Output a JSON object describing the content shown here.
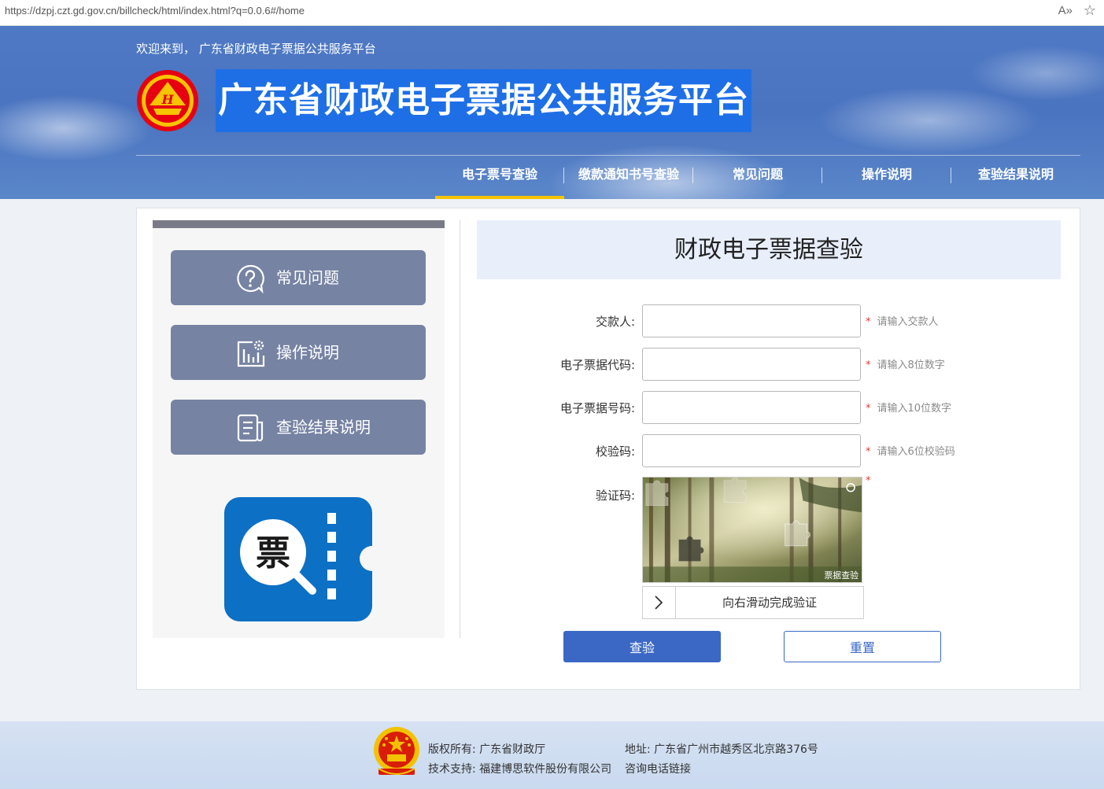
{
  "browser": {
    "url": "https://dzpj.czt.gd.gov.cn/billcheck/html/index.html?q=0.0.6#/home",
    "read_aloud": "A»",
    "favorite": "☆"
  },
  "header": {
    "welcome": "欢迎来到， 广东省财政电子票据公共服务平台",
    "title": "广东省财政电子票据公共服务平台",
    "emblem_char": "H",
    "nav": [
      "电子票号查验",
      "缴款通知书号查验",
      "常见问题",
      "操作说明",
      "查验结果说明"
    ],
    "active_nav": "电子票号查验"
  },
  "sidebar": {
    "items": [
      {
        "label": "常见问题",
        "icon": "question-icon"
      },
      {
        "label": "操作说明",
        "icon": "chart-settings-icon"
      },
      {
        "label": "查验结果说明",
        "icon": "document-icon"
      }
    ],
    "ticket_char": "票"
  },
  "form": {
    "heading": "财政电子票据查验",
    "fields": [
      {
        "label": "交款人:",
        "value": "",
        "hint": "请输入交款人"
      },
      {
        "label": "电子票据代码:",
        "value": "",
        "hint": "请输入8位数字"
      },
      {
        "label": "电子票据号码:",
        "value": "",
        "hint": "请输入10位数字"
      },
      {
        "label": "校验码:",
        "value": "",
        "hint": "请输入6位校验码"
      }
    ],
    "captcha_label": "验证码:",
    "captcha_watermark": "票据查验",
    "slider_text": "向右滑动完成验证",
    "required_mark": "*",
    "check_button": "查验",
    "reset_button": "重置"
  },
  "footer": {
    "copyright": "版权所有: 广东省财政厅",
    "tech": "技术支持: 福建博思软件股份有限公司",
    "address": "地址: 广东省广州市越秀区北京路376号",
    "phone": "咨询电话链接"
  },
  "colors": {
    "header_blue": "#4a74c0",
    "nav_active": "#f5c400",
    "sidebar_button": "#7683a3",
    "primary": "#3a68c4",
    "required": "#e23b3b",
    "ticket_blue": "#0c70c4"
  }
}
